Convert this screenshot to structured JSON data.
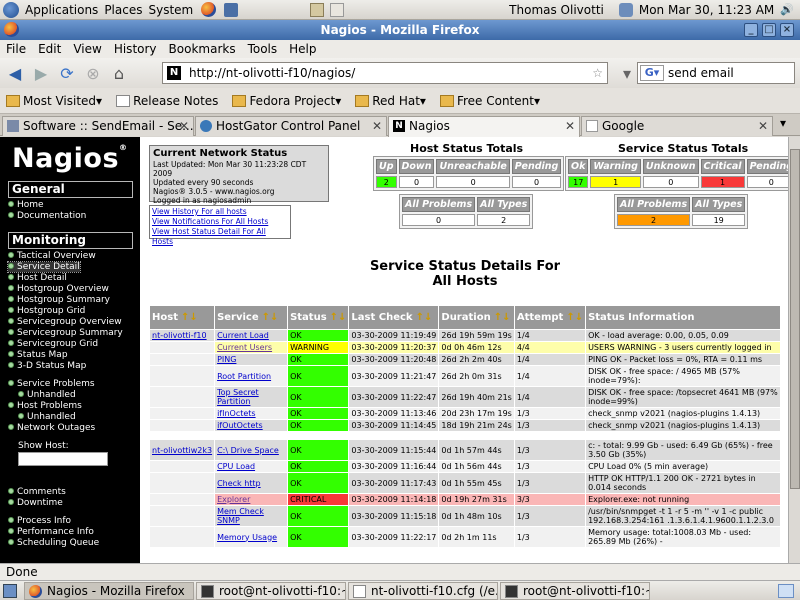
{
  "panel": {
    "menus": [
      "Applications",
      "Places",
      "System"
    ],
    "user": "Thomas Olivotti",
    "datetime": "Mon Mar 30, 11:23 AM"
  },
  "window": {
    "title": "Nagios - Mozilla Firefox"
  },
  "menubar": [
    "File",
    "Edit",
    "View",
    "History",
    "Bookmarks",
    "Tools",
    "Help"
  ],
  "nav": {
    "url": "http://nt-olivotti-f10/nagios/",
    "search": "send email",
    "url_favicon": "N"
  },
  "bookmarks": [
    "Most Visited",
    "Release Notes",
    "Fedora Project",
    "Red Hat",
    "Free Content"
  ],
  "tabs": [
    "Software :: SendEmail - Se...",
    "HostGator Control Panel",
    "Nagios",
    "Google"
  ],
  "sidebar": {
    "logo": "Nagios",
    "general": {
      "title": "General",
      "links": [
        "Home",
        "Documentation"
      ]
    },
    "monitoring": {
      "title": "Monitoring",
      "links": [
        "Tactical Overview",
        "Service Detail",
        "Host Detail",
        "Hostgroup Overview",
        "Hostgroup Summary",
        "Hostgroup Grid",
        "Servicegroup Overview",
        "Servicegroup Summary",
        "Servicegroup Grid",
        "Status Map",
        "3-D Status Map"
      ]
    },
    "problems": [
      "Service Problems",
      "Unhandled",
      "Host Problems",
      "Unhandled",
      "Network Outages"
    ],
    "show_host": "Show Host:",
    "bottom": [
      "Comments",
      "Downtime",
      "Process Info",
      "Performance Info",
      "Scheduling Queue"
    ]
  },
  "status": {
    "title": "Current Network Status",
    "lines": [
      "Last Updated: Mon Mar 30 11:23:28 CDT 2009",
      "Updated every 90 seconds",
      "Nagios® 3.0.5 - www.nagios.org",
      "Logged in as nagiosadmin"
    ],
    "links": [
      "View History For all hosts",
      "View Notifications For All Hosts",
      "View Host Status Detail For All Hosts"
    ]
  },
  "host_totals": {
    "title": "Host Status Totals",
    "headers": [
      "Up",
      "Down",
      "Unreachable",
      "Pending"
    ],
    "values": [
      "2",
      "0",
      "0",
      "0"
    ],
    "all_headers": [
      "All Problems",
      "All Types"
    ],
    "all_values": [
      "0",
      "2"
    ]
  },
  "service_totals": {
    "title": "Service Status Totals",
    "headers": [
      "Ok",
      "Warning",
      "Unknown",
      "Critical",
      "Pending"
    ],
    "values": [
      "17",
      "1",
      "0",
      "1",
      "0"
    ],
    "all_headers": [
      "All Problems",
      "All Types"
    ],
    "all_values": [
      "2",
      "19"
    ]
  },
  "service_table": {
    "title": "Service Status Details For All Hosts",
    "headers": [
      "Host",
      "Service",
      "Status",
      "Last Check",
      "Duration",
      "Attempt",
      "Status Information"
    ],
    "rows": [
      [
        "nt-olivotti-f10",
        "Current Load",
        "OK",
        "03-30-2009 11:19:49",
        "26d 19h 59m 19s",
        "1/4",
        "OK - load average: 0.00, 0.05, 0.09"
      ],
      [
        "",
        "Current Users",
        "WARNING",
        "03-30-2009 11:20:37",
        "0d 0h 46m 12s",
        "4/4",
        "USERS WARNING - 3 users currently logged in"
      ],
      [
        "",
        "PING",
        "OK",
        "03-30-2009 11:20:48",
        "26d 2h 2m 40s",
        "1/4",
        "PING OK - Packet loss = 0%, RTA = 0.11 ms"
      ],
      [
        "",
        "Root Partition",
        "OK",
        "03-30-2009 11:21:47",
        "26d 2h 0m 31s",
        "1/4",
        "DISK OK - free space: / 4965 MB (57% inode=79%):"
      ],
      [
        "",
        "Top Secret Partition",
        "OK",
        "03-30-2009 11:22:47",
        "26d 19h 40m 21s",
        "1/4",
        "DISK OK - free space: /topsecret 4641 MB (97% inode=99%)"
      ],
      [
        "",
        "ifInOctets",
        "OK",
        "03-30-2009 11:13:46",
        "20d 23h 17m 19s",
        "1/3",
        "check_snmp v2021 (nagios-plugins 1.4.13)"
      ],
      [
        "",
        "ifOutOctets",
        "OK",
        "03-30-2009 11:14:45",
        "18d 19h 21m 24s",
        "1/3",
        "check_snmp v2021 (nagios-plugins 1.4.13)"
      ],
      [
        "nt-olivottiw2k3",
        "C:\\ Drive Space",
        "OK",
        "03-30-2009 11:15:44",
        "0d 1h 57m 44s",
        "1/3",
        "c: - total: 9.99 Gb - used: 6.49 Gb (65%) - free 3.50 Gb (35%)"
      ],
      [
        "",
        "CPU Load",
        "OK",
        "03-30-2009 11:16:44",
        "0d 1h 56m 44s",
        "1/3",
        "CPU Load 0% (5 min average)"
      ],
      [
        "",
        "Check http",
        "OK",
        "03-30-2009 11:17:43",
        "0d 1h 55m 45s",
        "1/3",
        "HTTP OK HTTP/1.1 200 OK - 2721 bytes in 0.014 seconds"
      ],
      [
        "",
        "Explorer",
        "CRITICAL",
        "03-30-2009 11:14:18",
        "0d 19h 27m 31s",
        "3/3",
        "Explorer.exe: not running"
      ],
      [
        "",
        "Mem Check SNMP",
        "OK",
        "03-30-2009 11:15:18",
        "0d 1h 48m 10s",
        "1/3",
        "/usr/bin/snmpget -t 1 -r 5 -m '' -v 1 -c public 192.168.3.254:161 .1.3.6.1.4.1.9600.1.1.2.3.0"
      ],
      [
        "",
        "Memory Usage",
        "OK",
        "03-30-2009 11:22:17",
        "0d 2h 1m 11s",
        "1/3",
        "Memory usage: total:1008.03 Mb - used: 265.89 Mb (26%) -"
      ]
    ]
  },
  "statusbar": "Done",
  "taskbar": [
    "Nagios - Mozilla Firefox",
    "root@nt-olivotti-f10:~",
    "nt-olivotti-f10.cfg (/e...",
    "root@nt-olivotti-f10:~"
  ]
}
